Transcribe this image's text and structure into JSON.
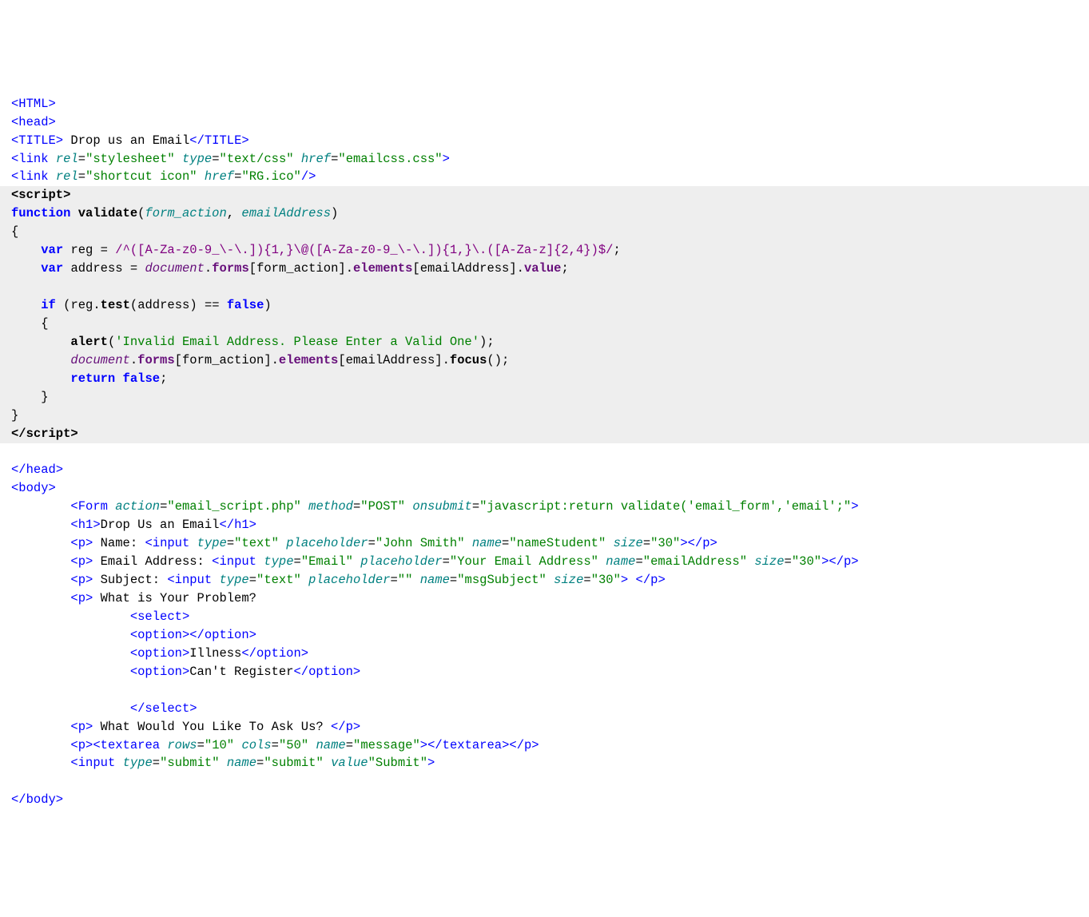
{
  "code": {
    "l1": {
      "tag_open": "<HTML>"
    },
    "l2": {
      "tag_open": "<head>"
    },
    "l3": {
      "tag_open": "<TITLE>",
      "text": " Drop us an Email",
      "tag_close": "</TITLE>"
    },
    "l4": {
      "tag": "link",
      "a1n": "rel",
      "a1v": "\"stylesheet\"",
      "a2n": "type",
      "a2v": "\"text/css\"",
      "a3n": "href",
      "a3v": "\"emailcss.css\""
    },
    "l5": {
      "tag": "link",
      "a1n": "rel",
      "a1v": "\"shortcut icon\"",
      "a2n": "href",
      "a2v": "\"RG.ico\""
    },
    "l6": {
      "tag_open": "<script>"
    },
    "l7": {
      "kw": "function",
      "fn": "validate",
      "p1": "form_action",
      "p2": "emailAddress"
    },
    "l8": {
      "brace": "{"
    },
    "l9": {
      "kw": "var",
      "name": "reg",
      "regex": "/^([A-Za-z0-9_\\-\\.]){1,}\\@([A-Za-z0-9_\\-\\.]){1,}\\.([A-Za-z]{2,4})$/"
    },
    "l10": {
      "kw": "var",
      "name": "address",
      "doc": "document",
      "forms": "forms",
      "arg1": "form_action",
      "elements": "elements",
      "arg2": "emailAddress",
      "value": "value"
    },
    "l11": {
      "kw": "if",
      "obj": "reg",
      "method": "test",
      "arg": "address",
      "false": "false"
    },
    "l12": {
      "brace": "{"
    },
    "l13": {
      "fn": "alert",
      "str": "'Invalid Email Address. Please Enter a Valid One'"
    },
    "l14": {
      "doc": "document",
      "forms": "forms",
      "arg1": "form_action",
      "elements": "elements",
      "arg2": "emailAddress",
      "focus": "focus"
    },
    "l15": {
      "kw": "return",
      "false": "false"
    },
    "l16": {
      "brace": "}"
    },
    "l17": {
      "brace": "}"
    },
    "l18": {
      "tag_close": "</script>"
    },
    "l19": {
      "tag_close": "</head>"
    },
    "l20": {
      "tag_open": "<body>"
    },
    "l21": {
      "tag": "Form",
      "a1n": "action",
      "a1v": "\"email_script.php\"",
      "a2n": "method",
      "a2v": "\"POST\"",
      "a3n": "onsubmit",
      "a3v": "\"javascript:return validate('email_form','email';\""
    },
    "l22": {
      "tag_open": "<h1>",
      "text": "Drop Us an Email",
      "tag_close": "</h1>"
    },
    "l23": {
      "tag_open": "<p>",
      "label": " Name: ",
      "input": "input",
      "a1n": "type",
      "a1v": "\"text\"",
      "a2n": "placeholder",
      "a2v": "\"John Smith\"",
      "a3n": "name",
      "a3v": "\"nameStudent\"",
      "a4n": "size",
      "a4v": "\"30\"",
      "tag_close": "</p>"
    },
    "l24": {
      "tag_open": "<p>",
      "label": " Email Address: ",
      "input": "input",
      "a1n": "type",
      "a1v": "\"Email\"",
      "a2n": "placeholder",
      "a2v": "\"Your Email Address\"",
      "a3n": "name",
      "a3v": "\"emailAddress\"",
      "a4n": "size",
      "a4v": "\"30\"",
      "tag_close": "</p>"
    },
    "l25": {
      "tag_open": "<p>",
      "label": " Subject: ",
      "input": "input",
      "a1n": "type",
      "a1v": "\"text\"",
      "a2n": "placeholder",
      "a2v": "\"\"",
      "a3n": "name",
      "a3v": "\"msgSubject\"",
      "a4n": "size",
      "a4v": "\"30\"",
      "tag_close": "</p>"
    },
    "l26": {
      "tag_open": "<p>",
      "text": " What is Your Problem?"
    },
    "l27": {
      "tag_open": "<select>"
    },
    "l28": {
      "tag_open": "<option>",
      "tag_close": "</option>"
    },
    "l29": {
      "tag_open": "<option>",
      "text": "Illness",
      "tag_close": "</option>"
    },
    "l30": {
      "tag_open": "<option>",
      "text": "Can't Register",
      "tag_close": "</option>"
    },
    "l31": {
      "tag_close": "</select>"
    },
    "l32": {
      "tag_open": "<p>",
      "text": " What Would You Like To Ask Us? ",
      "tag_close": "</p>"
    },
    "l33": {
      "tag_open": "<p>",
      "ta": "textarea",
      "a1n": "rows",
      "a1v": "\"10\"",
      "a2n": "cols",
      "a2v": "\"50\"",
      "a3n": "name",
      "a3v": "\"message\"",
      "ta_close": "</textarea>",
      "tag_close": "</p>"
    },
    "l34": {
      "tag": "input",
      "a1n": "type",
      "a1v": "\"submit\"",
      "a2n": "name",
      "a2v": "\"submit\"",
      "a3n": "value",
      "a3v": "\"Submit\""
    },
    "l35": {
      "tag_close": "</body>"
    }
  }
}
